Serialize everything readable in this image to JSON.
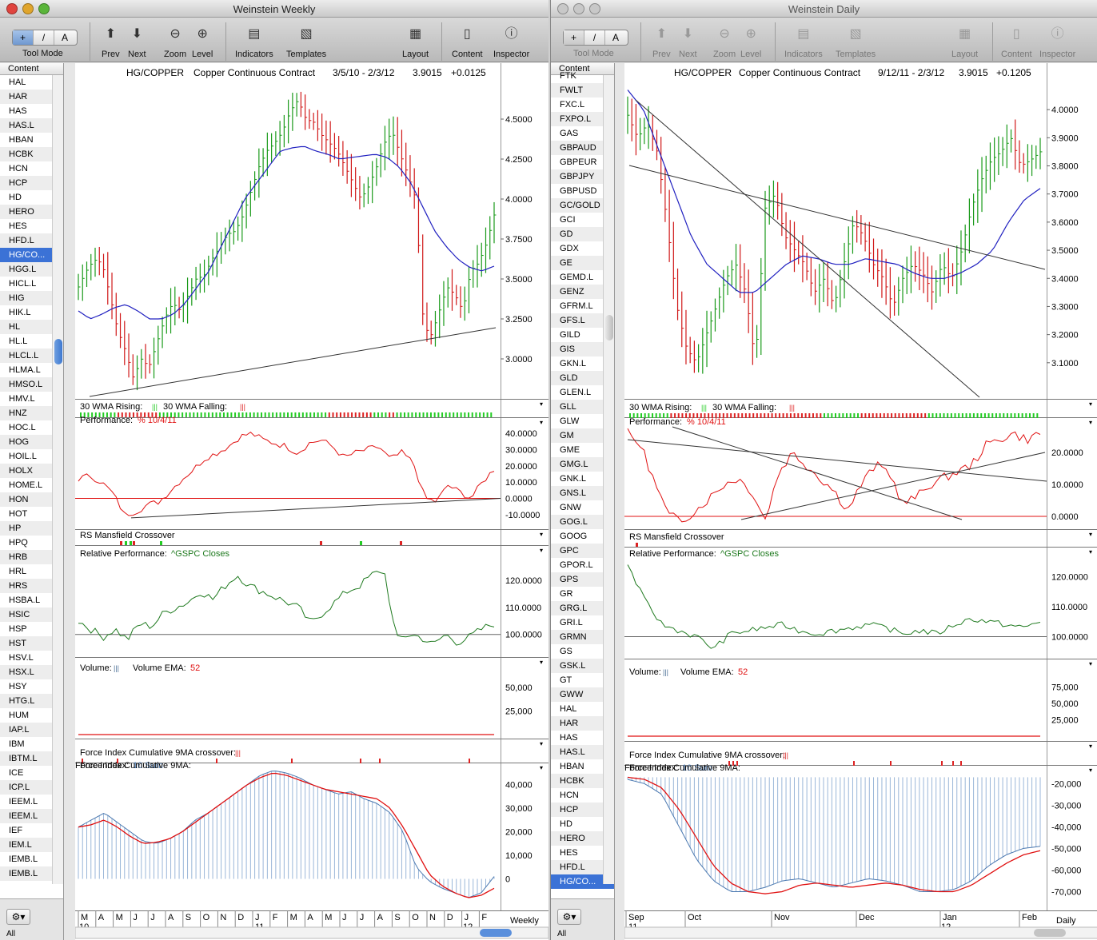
{
  "left_window": {
    "title": "Weinstein Weekly",
    "toolbar": {
      "tool_mode_label": "Tool Mode",
      "tool_mode_buttons": [
        "+",
        "/",
        "A"
      ],
      "prev_label": "Prev",
      "next_label": "Next",
      "zoom_label": "Zoom",
      "level_label": "Level",
      "indicators_label": "Indicators",
      "templates_label": "Templates",
      "layout_label": "Layout",
      "content_label": "Content",
      "inspector_label": "Inspector"
    },
    "sidebar": {
      "header": "Content",
      "selected": "HG/CO...",
      "items": [
        "HAL",
        "HAR",
        "HAS",
        "HAS.L",
        "HBAN",
        "HCBK",
        "HCN",
        "HCP",
        "HD",
        "HERO",
        "HES",
        "HFD.L",
        "HG/CO...",
        "HGG.L",
        "HICL.L",
        "HIG",
        "HIK.L",
        "HL",
        "HL.L",
        "HLCL.L",
        "HLMA.L",
        "HMSO.L",
        "HMV.L",
        "HNZ",
        "HOC.L",
        "HOG",
        "HOIL.L",
        "HOLX",
        "HOME.L",
        "HON",
        "HOT",
        "HP",
        "HPQ",
        "HRB",
        "HRL",
        "HRS",
        "HSBA.L",
        "HSIC",
        "HSP",
        "HST",
        "HSV.L",
        "HSX.L",
        "HSY",
        "HTG.L",
        "HUM",
        "IAP.L",
        "IBM",
        "IBTM.L",
        "ICE",
        "ICP.L",
        "IEEM.L",
        "IEEM.L",
        "IEF",
        "IEM.L",
        "IEMB.L",
        "IEMB.L"
      ],
      "all_label": "All"
    },
    "chart": {
      "header": {
        "symbol": "HG/COPPER",
        "name": "Copper Continuous Contract",
        "range": "3/5/10 - 2/3/12",
        "last": "3.9015",
        "change": "+0.0125"
      },
      "price_ticks": [
        "4.5000",
        "4.2500",
        "4.0000",
        "3.7500",
        "3.5000",
        "3.2500",
        "3.0000"
      ],
      "wma_label_rising": "30 WMA Rising:",
      "wma_label_falling": "30 WMA Falling:",
      "perf_label": "Performance:",
      "perf_ref": "% 10/4/11",
      "perf_ticks": [
        "40.0000",
        "30.0000",
        "20.0000",
        "10.0000",
        "0.0000",
        "-10.0000"
      ],
      "rs_label": "RS Mansfield Crossover",
      "rel_label": "Relative Performance:",
      "rel_ref": "^GSPC Closes",
      "rel_ticks": [
        "120.0000",
        "110.0000",
        "100.0000"
      ],
      "vol_label": "Volume:",
      "vol_ema_label": "Volume EMA:",
      "vol_ema_value": "52",
      "vol_ticks": [
        "50,000",
        "25,000"
      ],
      "fic_label": "Force Index Cumulative 9MA crossover:",
      "fi_label": "Force Index:",
      "fi_sum": "10 Sum",
      "fi_cum_label": "Force Index Cumulative 9MA:",
      "fi_ticks": [
        "40,000",
        "30,000",
        "20,000",
        "10,000",
        "0"
      ],
      "months": [
        "M",
        "A",
        "M",
        "J",
        "J",
        "A",
        "S",
        "O",
        "N",
        "D",
        "J",
        "F",
        "M",
        "A",
        "M",
        "J",
        "J",
        "A",
        "S",
        "O",
        "N",
        "D",
        "J",
        "F"
      ],
      "years": [
        "10",
        "11",
        "12"
      ],
      "period": "Weekly"
    }
  },
  "right_window": {
    "title": "Weinstein Daily",
    "toolbar": {
      "tool_mode_label": "Tool Mode",
      "tool_mode_buttons": [
        "+",
        "/",
        "A"
      ],
      "prev_label": "Prev",
      "next_label": "Next",
      "zoom_label": "Zoom",
      "level_label": "Level",
      "indicators_label": "Indicators",
      "templates_label": "Templates",
      "layout_label": "Layout",
      "content_label": "Content",
      "inspector_label": "Inspector"
    },
    "sidebar": {
      "header": "Content",
      "selected": "HG/CO...",
      "items": [
        "FTK",
        "FWLT",
        "FXC.L",
        "FXPO.L",
        "GAS",
        "GBPAUD",
        "GBPEUR",
        "GBPJPY",
        "GBPUSD",
        "GC/GOLD",
        "GCI",
        "GD",
        "GDX",
        "GE",
        "GEMD.L",
        "GENZ",
        "GFRM.L",
        "GFS.L",
        "GILD",
        "GIS",
        "GKN.L",
        "GLD",
        "GLEN.L",
        "GLL",
        "GLW",
        "GM",
        "GME",
        "GMG.L",
        "GNK.L",
        "GNS.L",
        "GNW",
        "GOG.L",
        "GOOG",
        "GPC",
        "GPOR.L",
        "GPS",
        "GR",
        "GRG.L",
        "GRI.L",
        "GRMN",
        "GS",
        "GSK.L",
        "GT",
        "GWW",
        "HAL",
        "HAR",
        "HAS",
        "HAS.L",
        "HBAN",
        "HCBK",
        "HCN",
        "HCP",
        "HD",
        "HERO",
        "HES",
        "HFD.L",
        "HG/CO..."
      ],
      "all_label": "All"
    },
    "chart": {
      "header": {
        "symbol": "HG/COPPER",
        "name": "Copper Continuous Contract",
        "range": "9/12/11 - 2/3/12",
        "last": "3.9015",
        "change": "+0.1205"
      },
      "price_ticks": [
        "4.0000",
        "3.9000",
        "3.8000",
        "3.7000",
        "3.6000",
        "3.5000",
        "3.4000",
        "3.3000",
        "3.2000",
        "3.1000"
      ],
      "wma_label_rising": "30 WMA Rising:",
      "wma_label_falling": "30 WMA Falling:",
      "perf_label": "Performance:",
      "perf_ref": "% 10/4/11",
      "perf_ticks": [
        "20.0000",
        "10.0000",
        "0.0000"
      ],
      "rs_label": "RS Mansfield Crossover",
      "rel_label": "Relative Performance:",
      "rel_ref": "^GSPC Closes",
      "rel_ticks": [
        "120.0000",
        "110.0000",
        "100.0000"
      ],
      "vol_label": "Volume:",
      "vol_ema_label": "Volume EMA:",
      "vol_ema_value": "52",
      "vol_ticks": [
        "75,000",
        "50,000",
        "25,000"
      ],
      "fic_label": "Force Index Cumulative 9MA crossover:",
      "fi_label": "Force Index:",
      "fi_sum": "10 Sum",
      "fi_cum_label": "Force Index Cumulative 9MA:",
      "fi_ticks": [
        "-20,000",
        "-30,000",
        "-40,000",
        "-50,000",
        "-60,000",
        "-70,000"
      ],
      "months": [
        "Sep",
        "Oct",
        "Nov",
        "Dec",
        "Jan",
        "Feb"
      ],
      "years": [
        "11",
        "12"
      ],
      "period": "Daily"
    }
  },
  "colors": {
    "up": "#1a9a1a",
    "down": "#d01818",
    "ma": "#2020c0",
    "perf": "#e01010",
    "rel": "#1f7a1f",
    "vol": "#4a6e96",
    "fi": "#4a78b0",
    "wma_rising": "#22cc22",
    "wma_falling": "#dd2222",
    "trend": "#333333"
  },
  "chart_data": [
    {
      "type": "line",
      "title": "HG/COPPER Copper Continuous Contract (Weekly)",
      "period": "3/5/10 - 2/3/12",
      "series": [
        {
          "name": "Price",
          "values": [
            3.45,
            3.55,
            3.62,
            3.6,
            3.4,
            3.18,
            3.05,
            2.88,
            3.0,
            2.95,
            3.1,
            3.25,
            3.35,
            3.3,
            3.4,
            3.5,
            3.52,
            3.62,
            3.7,
            3.78,
            3.8,
            3.9,
            4.05,
            4.2,
            4.3,
            4.35,
            4.42,
            4.55,
            4.62,
            4.5,
            4.48,
            4.4,
            4.35,
            4.3,
            4.2,
            4.1,
            4.0,
            4.08,
            4.2,
            4.35,
            4.42,
            4.28,
            4.15,
            4.0,
            3.2,
            3.15,
            3.3,
            3.45,
            3.4,
            3.3,
            3.55,
            3.6,
            3.72,
            3.9
          ]
        },
        {
          "name": "30 WMA",
          "values": [
            3.3,
            3.25,
            3.28,
            3.32,
            3.34,
            3.3,
            3.25,
            3.25,
            3.28,
            3.35,
            3.45,
            3.55,
            3.7,
            3.85,
            4.0,
            4.1,
            4.2,
            4.3,
            4.32,
            4.33,
            4.3,
            4.28,
            4.25,
            4.26,
            4.27,
            4.28,
            4.26,
            4.2,
            4.1,
            3.95,
            3.8,
            3.7,
            3.62,
            3.57,
            3.55,
            3.58
          ]
        }
      ]
    },
    {
      "type": "line",
      "title": "HG/COPPER Copper Continuous Contract (Daily)",
      "period": "9/12/11 - 2/3/12",
      "series": [
        {
          "name": "Price",
          "values": [
            3.98,
            3.9,
            3.95,
            3.85,
            3.6,
            3.3,
            3.15,
            3.1,
            3.2,
            3.3,
            3.4,
            3.45,
            3.35,
            3.1,
            3.65,
            3.7,
            3.55,
            3.5,
            3.45,
            3.35,
            3.4,
            3.3,
            3.45,
            3.6,
            3.55,
            3.45,
            3.4,
            3.3,
            3.4,
            3.45,
            3.42,
            3.35,
            3.45,
            3.4,
            3.5,
            3.65,
            3.75,
            3.82,
            3.85,
            3.9,
            3.8,
            3.82,
            3.85
          ]
        },
        {
          "name": "MA",
          "values": [
            4.07,
            4.0,
            3.85,
            3.7,
            3.55,
            3.45,
            3.4,
            3.35,
            3.35,
            3.4,
            3.45,
            3.48,
            3.47,
            3.45,
            3.45,
            3.47,
            3.46,
            3.45,
            3.42,
            3.4,
            3.4,
            3.42,
            3.45,
            3.5,
            3.6,
            3.68,
            3.72
          ]
        }
      ]
    }
  ]
}
